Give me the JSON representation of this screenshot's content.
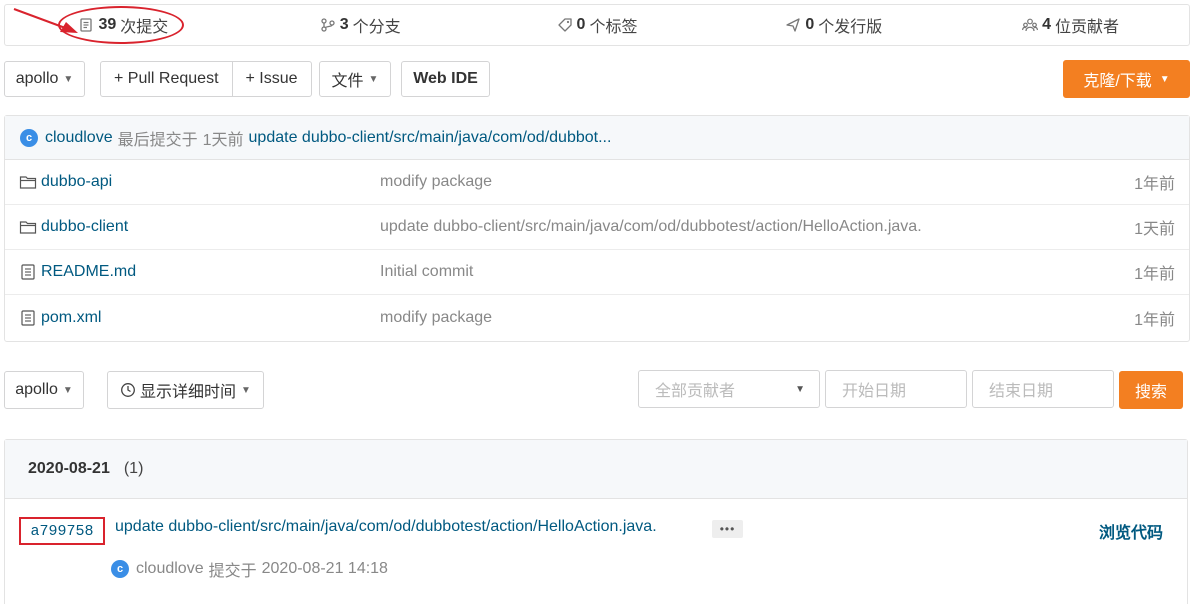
{
  "stats": {
    "commits_count": "39",
    "commits_label": "次提交",
    "branches_count": "3",
    "branches_label": "个分支",
    "tags_count": "0",
    "tags_label": "个标签",
    "releases_count": "0",
    "releases_label": "个发行版",
    "contributors_count": "4",
    "contributors_label": "位贡献者"
  },
  "toolbar": {
    "branch": "apollo",
    "pull_request": "+ Pull Request",
    "issue": "+ Issue",
    "file_menu": "文件",
    "web_ide": "Web IDE",
    "clone": "克隆/下载"
  },
  "last_commit": {
    "avatar_letter": "c",
    "author": "cloudlove",
    "label": "最后提交于",
    "time": "1天前",
    "message": "update dubbo-client/src/main/java/com/od/dubbot..."
  },
  "files": [
    {
      "name": "dubbo-api",
      "type": "folder",
      "message": "modify package",
      "time": "1年前"
    },
    {
      "name": "dubbo-client",
      "type": "folder",
      "message": "update dubbo-client/src/main/java/com/od/dubbotest/action/HelloAction.java.",
      "time": "1天前"
    },
    {
      "name": "README.md",
      "type": "file",
      "message": "Initial commit",
      "time": "1年前"
    },
    {
      "name": "pom.xml",
      "type": "file",
      "message": "modify package",
      "time": "1年前"
    }
  ],
  "filter": {
    "branch": "apollo",
    "detail_time": "显示详细时间",
    "all_contributors": "全部贡献者",
    "start_date": "开始日期",
    "end_date": "结束日期",
    "search": "搜索"
  },
  "commit_group": {
    "date": "2020-08-21",
    "count": "(1)",
    "sha": "a799758",
    "message": "update dubbo-client/src/main/java/com/od/dubbotest/action/HelloAction.java.",
    "more": "•••",
    "browse": "浏览代码",
    "avatar_letter": "c",
    "author": "cloudlove",
    "committed_label": "提交于",
    "timestamp": "2020-08-21 14:18"
  },
  "colors": {
    "accent": "#f37f21",
    "link": "#005980",
    "annotation": "#d9232d",
    "avatar": "#3a8ee6"
  }
}
